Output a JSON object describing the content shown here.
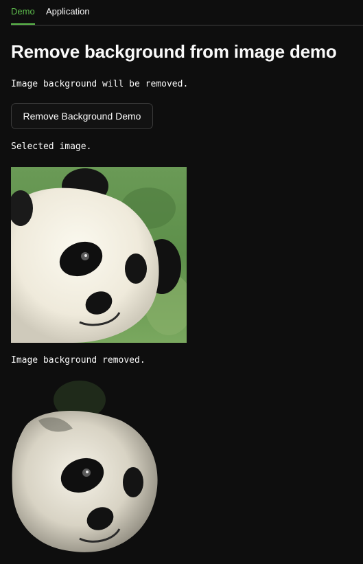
{
  "tabs": [
    {
      "label": "Demo",
      "active": true
    },
    {
      "label": "Application",
      "active": false
    }
  ],
  "page": {
    "title": "Remove background from image demo",
    "intro": "Image background will be removed.",
    "button_label": "Remove Background Demo",
    "selected_caption": "Selected image.",
    "removed_caption": "Image background removed."
  },
  "colors": {
    "background": "#0e0e0e",
    "accent": "#5fbf4e",
    "text": "#fafafa"
  },
  "icons": {
    "selected_image": "panda-photo",
    "removed_image": "panda-cutout"
  }
}
